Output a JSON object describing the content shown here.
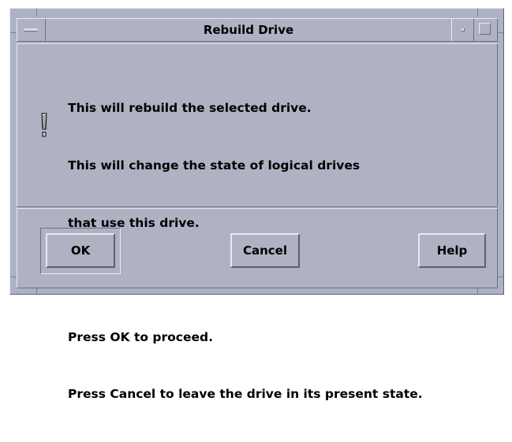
{
  "dialog": {
    "title": "Rebuild Drive",
    "icon": "exclamation-warning-icon",
    "message_lines": [
      "This will rebuild the selected drive.",
      "This will change the state of logical drives",
      "that use this drive.",
      "Press OK to proceed.",
      "Press Cancel to leave the drive in its present state."
    ],
    "buttons": {
      "ok": "OK",
      "cancel": "Cancel",
      "help": "Help"
    }
  },
  "colors": {
    "background": "#aeb2c3",
    "highlight": "#e8eaf1",
    "shadow": "#5c6070",
    "text": "#000000"
  }
}
